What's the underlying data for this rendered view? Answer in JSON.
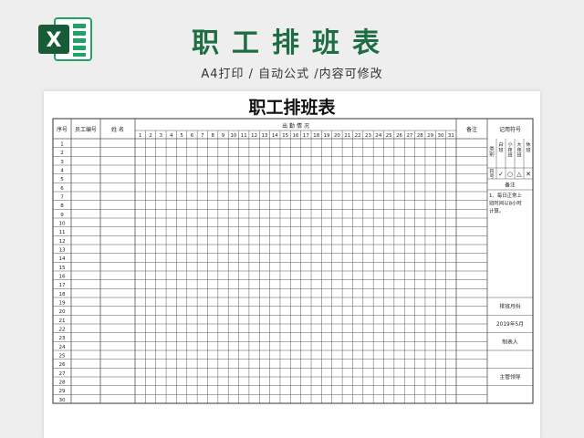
{
  "banner": {
    "title": "职工排班表",
    "subtitle": "A4打印 / 自动公式 /内容可修改"
  },
  "colors": {
    "brand_green": "#1e6d44",
    "excel_green_dark": "#185c37",
    "excel_green": "#21a366",
    "grid_line": "#555555"
  },
  "sheet": {
    "title": "职工排班表",
    "headers": {
      "seq": "序号",
      "emp_no": "员工编号",
      "name": "姓 名",
      "attendance": "出  勤  情  况",
      "remark": "备注",
      "symbol_key": "记用符号"
    },
    "days": [
      "1",
      "2",
      "3",
      "4",
      "5",
      "6",
      "7",
      "8",
      "9",
      "10",
      "11",
      "12",
      "13",
      "14",
      "15",
      "16",
      "17",
      "18",
      "19",
      "20",
      "21",
      "22",
      "23",
      "24",
      "25",
      "26",
      "27",
      "28",
      "29",
      "30",
      "31"
    ],
    "row_numbers": [
      "1",
      "2",
      "3",
      "4",
      "5",
      "6",
      "7",
      "8",
      "9",
      "10",
      "11",
      "12",
      "13",
      "14",
      "15",
      "16",
      "17",
      "18",
      "19",
      "20",
      "21",
      "22",
      "23",
      "24",
      "25",
      "26",
      "27",
      "28",
      "29",
      "30"
    ],
    "side_panel": {
      "category_label": "类别",
      "shift_types": [
        "白班",
        "小夜班",
        "大夜班",
        "休班"
      ],
      "symbol_label": "符号",
      "symbols": [
        "✓",
        "○",
        "△",
        "✕"
      ],
      "remark_label": "备注",
      "remark_text_lines": [
        "1、每日正常上",
        "班时间以8小时",
        "计算。"
      ],
      "schedule_month_label": "排班月份",
      "schedule_month_value": "2019年5月",
      "preparer_label": "制表人",
      "supervisor_label": "主管领导"
    }
  }
}
